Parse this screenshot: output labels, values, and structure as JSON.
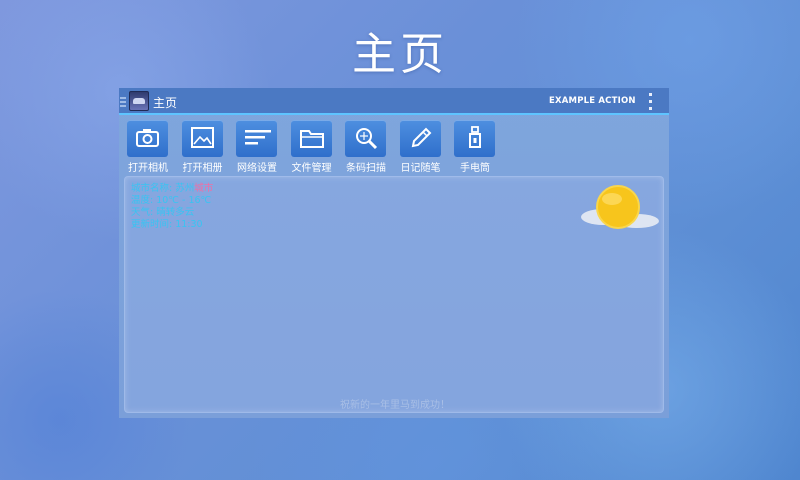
{
  "page": {
    "title": "主页"
  },
  "action_bar": {
    "title": "主页",
    "action_label": "EXAMPLE ACTION",
    "overflow_icon": "overflow-menu-icon",
    "app_icon": "app-logo-icon"
  },
  "toolbar": {
    "items": [
      {
        "label": "打开相机",
        "icon": "camera-icon"
      },
      {
        "label": "打开相册",
        "icon": "photo-album-icon"
      },
      {
        "label": "网络设置",
        "icon": "network-settings-icon"
      },
      {
        "label": "文件管理",
        "icon": "folder-icon"
      },
      {
        "label": "条码扫描",
        "icon": "barcode-scan-icon"
      },
      {
        "label": "日记随笔",
        "icon": "pencil-icon"
      },
      {
        "label": "手电筒",
        "icon": "flashlight-icon"
      }
    ]
  },
  "weather": {
    "city_label": "城市名称: 苏州",
    "city_name": "城市",
    "temperature": "温度: 10℃ - 16℃",
    "condition": "天气: 晴转多云",
    "update_time": "更新时间: 11:30",
    "icon": "sunny-cloudy-icon",
    "colors": {
      "text": "#38c4f2",
      "city": "#ee6fa6",
      "sun": "#f7c51c"
    }
  },
  "footer": {
    "message": "祝新的一年里马到成功！"
  },
  "colors": {
    "action_bar": "#4b79c3",
    "accent_line": "#5ec4ff",
    "tool_button": "#3b7fd6"
  }
}
